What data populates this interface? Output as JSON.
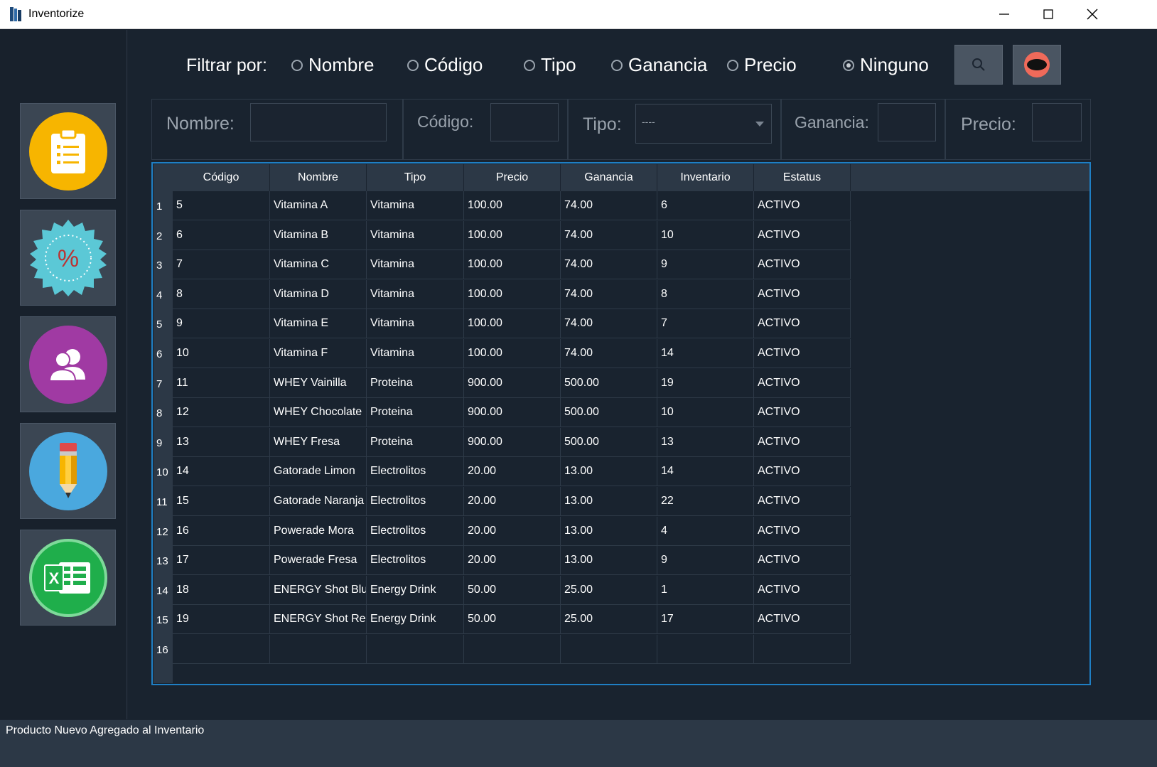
{
  "window": {
    "title": "Inventorize"
  },
  "filter": {
    "label": "Filtrar por:",
    "options": [
      "Nombre",
      "Código",
      "Tipo",
      "Ganancia",
      "Precio",
      "Ninguno"
    ],
    "selected": "Ninguno"
  },
  "fields": {
    "nombre_label": "Nombre:",
    "codigo_label": "Código:",
    "tipo_label": "Tipo:",
    "tipo_value": "----",
    "ganancia_label": "Ganancia:",
    "precio_label": "Precio:"
  },
  "table": {
    "columns": [
      "Código",
      "Nombre",
      "Tipo",
      "Precio",
      "Ganancia",
      "Inventario",
      "Estatus"
    ],
    "rows": [
      [
        "5",
        "Vitamina A",
        "Vitamina",
        "100.00",
        "74.00",
        "6",
        "ACTIVO"
      ],
      [
        "6",
        "Vitamina B",
        "Vitamina",
        "100.00",
        "74.00",
        "10",
        "ACTIVO"
      ],
      [
        "7",
        "Vitamina C",
        "Vitamina",
        "100.00",
        "74.00",
        "9",
        "ACTIVO"
      ],
      [
        "8",
        "Vitamina D",
        "Vitamina",
        "100.00",
        "74.00",
        "8",
        "ACTIVO"
      ],
      [
        "9",
        "Vitamina E",
        "Vitamina",
        "100.00",
        "74.00",
        "7",
        "ACTIVO"
      ],
      [
        "10",
        "Vitamina F",
        "Vitamina",
        "100.00",
        "74.00",
        "14",
        "ACTIVO"
      ],
      [
        "11",
        "WHEY Vainilla",
        "Proteina",
        "900.00",
        "500.00",
        "19",
        "ACTIVO"
      ],
      [
        "12",
        "WHEY Chocolate",
        "Proteina",
        "900.00",
        "500.00",
        "10",
        "ACTIVO"
      ],
      [
        "13",
        "WHEY Fresa",
        "Proteina",
        "900.00",
        "500.00",
        "13",
        "ACTIVO"
      ],
      [
        "14",
        "Gatorade Limon",
        "Electrolitos",
        "20.00",
        "13.00",
        "14",
        "ACTIVO"
      ],
      [
        "15",
        "Gatorade Naranja",
        "Electrolitos",
        "20.00",
        "13.00",
        "22",
        "ACTIVO"
      ],
      [
        "16",
        "Powerade Mora",
        "Electrolitos",
        "20.00",
        "13.00",
        "4",
        "ACTIVO"
      ],
      [
        "17",
        "Powerade Fresa",
        "Electrolitos",
        "20.00",
        "13.00",
        "9",
        "ACTIVO"
      ],
      [
        "18",
        "ENERGY Shot Blue",
        "Energy Drink",
        "50.00",
        "25.00",
        "1",
        "ACTIVO"
      ],
      [
        "19",
        "ENERGY Shot Red",
        "Energy Drink",
        "50.00",
        "25.00",
        "17",
        "ACTIVO"
      ],
      [
        "",
        "",
        "",
        "",
        "",
        "",
        ""
      ]
    ]
  },
  "sidebar": {
    "buttons": [
      {
        "icon": "clipboard-icon",
        "color": "#f7b500"
      },
      {
        "icon": "percent-badge-icon",
        "color": "#5bc8d6"
      },
      {
        "icon": "users-icon",
        "color": "#a03aa3"
      },
      {
        "icon": "pencil-icon",
        "color": "#4aa8de"
      },
      {
        "icon": "excel-icon",
        "color": "#1fae4b"
      }
    ]
  },
  "colors": {
    "accent": "#1f7fc4",
    "background": "#19232f",
    "header": "#2c3846"
  },
  "status": {
    "message": "Producto Nuevo Agregado al Inventario"
  }
}
